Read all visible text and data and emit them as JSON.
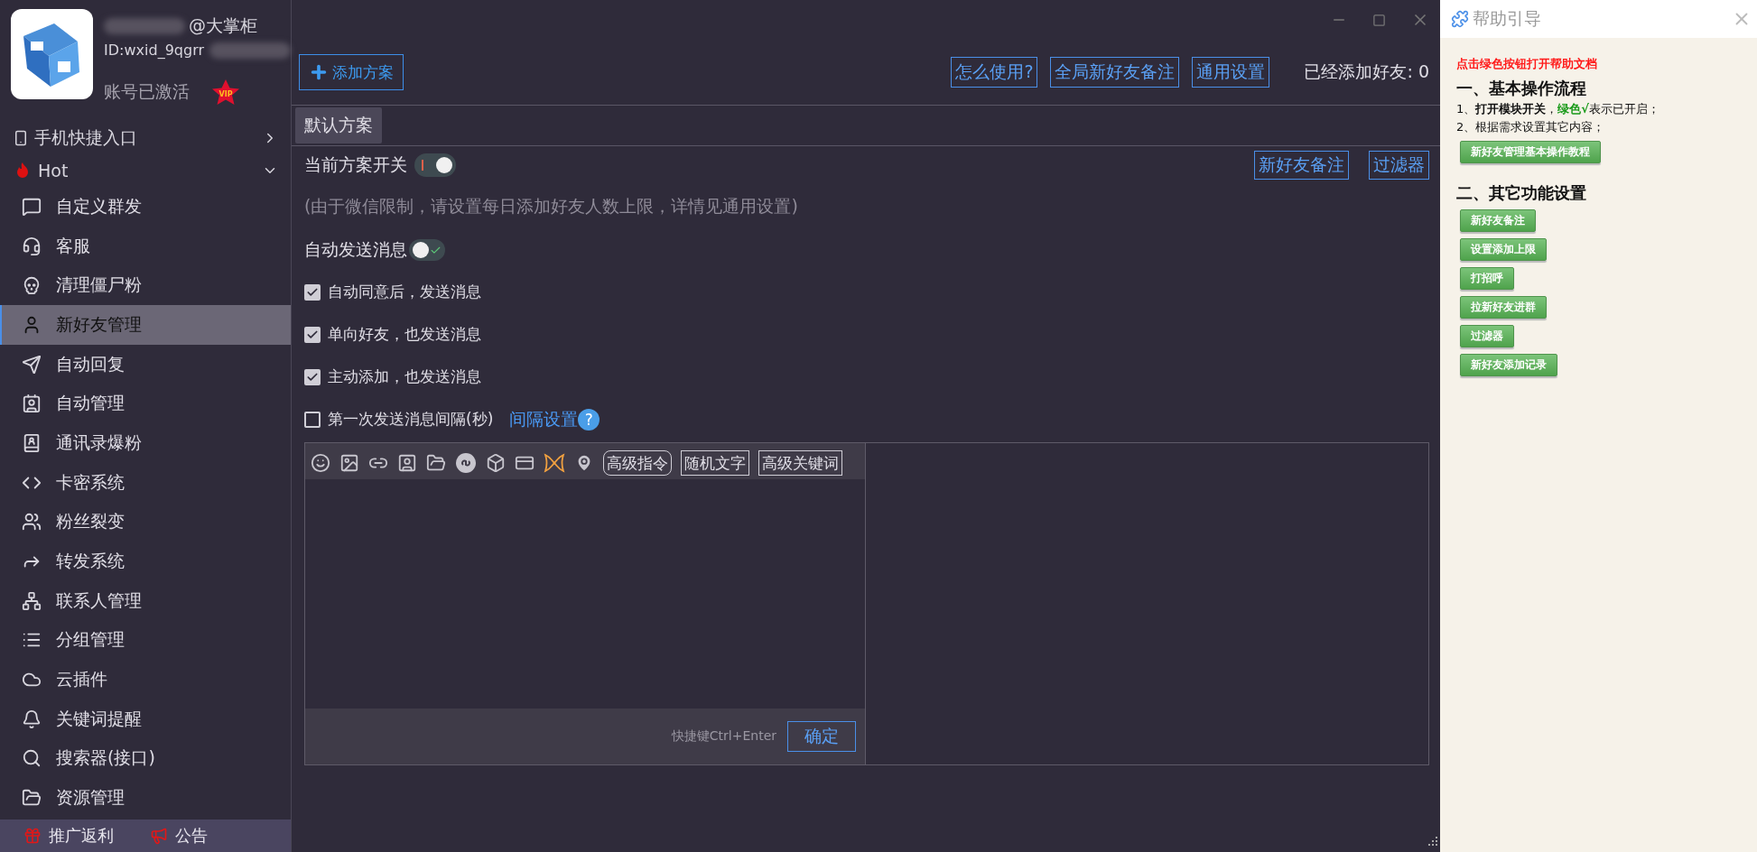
{
  "profile": {
    "name": "@大掌柜",
    "id": "ID:wxid_9qgrr",
    "status": "账号已激活",
    "badge": "VIP"
  },
  "sidebar": {
    "sections": [
      {
        "label": "手机快捷入口",
        "expanded": false
      },
      {
        "label": "Hot",
        "expanded": true,
        "children": [
          {
            "label": "自定义群发",
            "selected": false
          },
          {
            "label": "客服",
            "selected": false
          },
          {
            "label": "清理僵尸粉",
            "selected": false
          },
          {
            "label": "新好友管理",
            "selected": true
          },
          {
            "label": "自动回复",
            "selected": false
          },
          {
            "label": "自动管理",
            "selected": false
          },
          {
            "label": "通讯录爆粉",
            "selected": false
          },
          {
            "label": "卡密系统",
            "selected": false
          },
          {
            "label": "粉丝裂变",
            "selected": false
          },
          {
            "label": "转发系统",
            "selected": false
          },
          {
            "label": "联系人管理",
            "selected": false
          },
          {
            "label": "分组管理",
            "selected": false
          },
          {
            "label": "云插件",
            "selected": false
          },
          {
            "label": "关键词提醒",
            "selected": false
          },
          {
            "label": "搜索器(接口)",
            "selected": false
          },
          {
            "label": "资源管理",
            "selected": false
          }
        ]
      }
    ],
    "footer": [
      "推广返利",
      "公告"
    ]
  },
  "toolbar": {
    "add_button": "添加方案",
    "links": [
      "怎么使用?",
      "全局新好友备注",
      "通用设置"
    ],
    "added_count": "已经添加好友: 0"
  },
  "tabs": [
    {
      "label": "默认方案",
      "selected": true
    }
  ],
  "plan": {
    "switch_label": "当前方案开关",
    "switch_on": true,
    "side_buttons": [
      "新好友备注",
      "过滤器"
    ],
    "note": "(由于微信限制，请设置每日添加好友人数上限，详情见通用设置)",
    "auto_send_label": "自动发送消息",
    "auto_send_on": false,
    "checks": [
      {
        "label": "自动同意后，发送消息",
        "checked": true
      },
      {
        "label": "单向好友，也发送消息",
        "checked": true
      },
      {
        "label": "主动添加，也发送消息",
        "checked": true
      },
      {
        "label": "第一次发送消息间隔(秒)",
        "checked": false
      }
    ],
    "interval_link": "间隔设置",
    "help_mark": "?"
  },
  "editor": {
    "tool_buttons": [
      {
        "label": "高级指令",
        "kind": "rounded"
      },
      {
        "label": "随机文字",
        "kind": "square"
      },
      {
        "label": "高级关键词",
        "kind": "square"
      }
    ],
    "shortcut": "快捷键Ctrl+Enter",
    "confirm": "确定"
  },
  "help": {
    "title": "帮助引导",
    "intro": "点击绿色按钮打开帮助文档",
    "section1": "一、基本操作流程",
    "step1": {
      "before": "1、**打开模块开关**，",
      "highlight": "绿色√",
      "after": "表示已开启；"
    },
    "step2": "2、根据需求设置其它内容；",
    "tutorial_button": "新好友管理基本操作教程",
    "section2": "二、其它功能设置",
    "buttons": [
      "新好友备注",
      "设置添加上限",
      "打招呼",
      "拉新好友进群",
      "过滤器",
      "新好友添加记录"
    ]
  }
}
